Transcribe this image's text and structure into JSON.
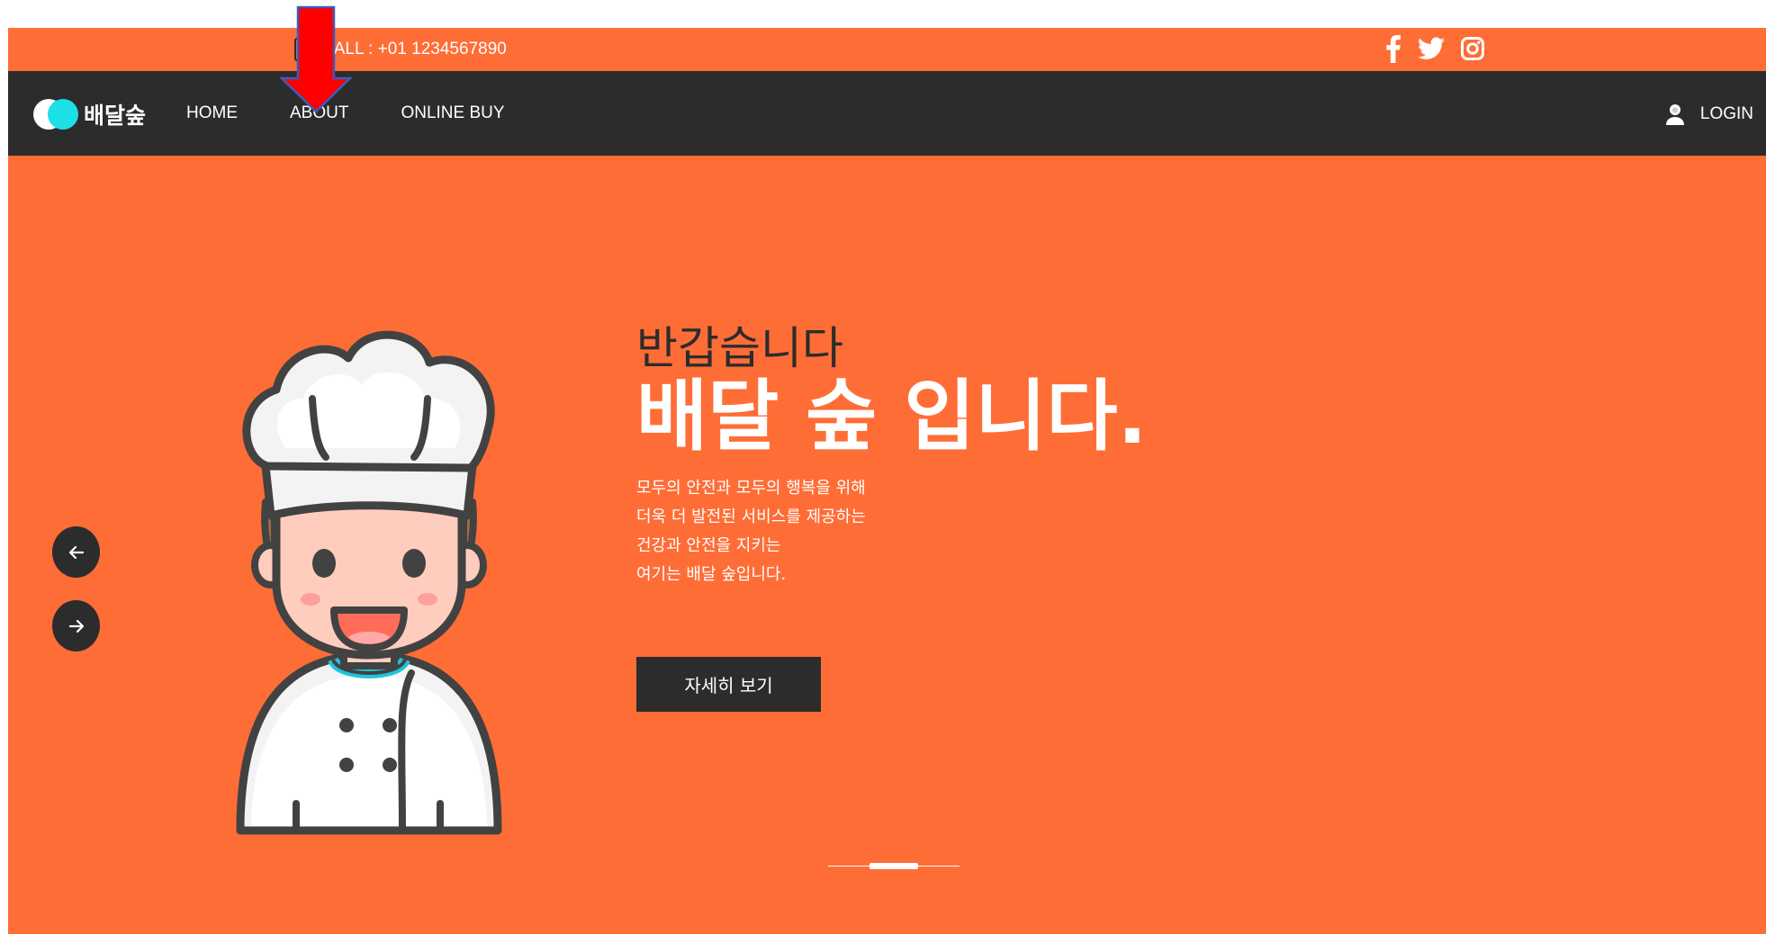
{
  "topbar": {
    "call_text": "CALL : +01 1234567890",
    "social_icons": [
      "facebook-icon",
      "twitter-icon",
      "instagram-icon"
    ]
  },
  "nav": {
    "logo_text": "배달숲",
    "items": [
      {
        "label": "HOME"
      },
      {
        "label": "ABOUT"
      },
      {
        "label": "ONLINE BUY"
      }
    ],
    "login_label": "LOGIN"
  },
  "hero": {
    "greeting": "반갑습니다",
    "headline": "배달 숲 입니다.",
    "description_lines": [
      "모두의 안전과 모두의 행복을 위해",
      "더욱 더 발전된 서비스를 제공하는",
      "건강과 안전을 지키는",
      "여기는 배달 숲입니다."
    ],
    "cta_label": "자세히 보기"
  },
  "colors": {
    "accent": "#ff6d36",
    "dark": "#2c2c2c",
    "logo_teal": "#1ce0e6",
    "annotation_red": "#ff0000"
  }
}
